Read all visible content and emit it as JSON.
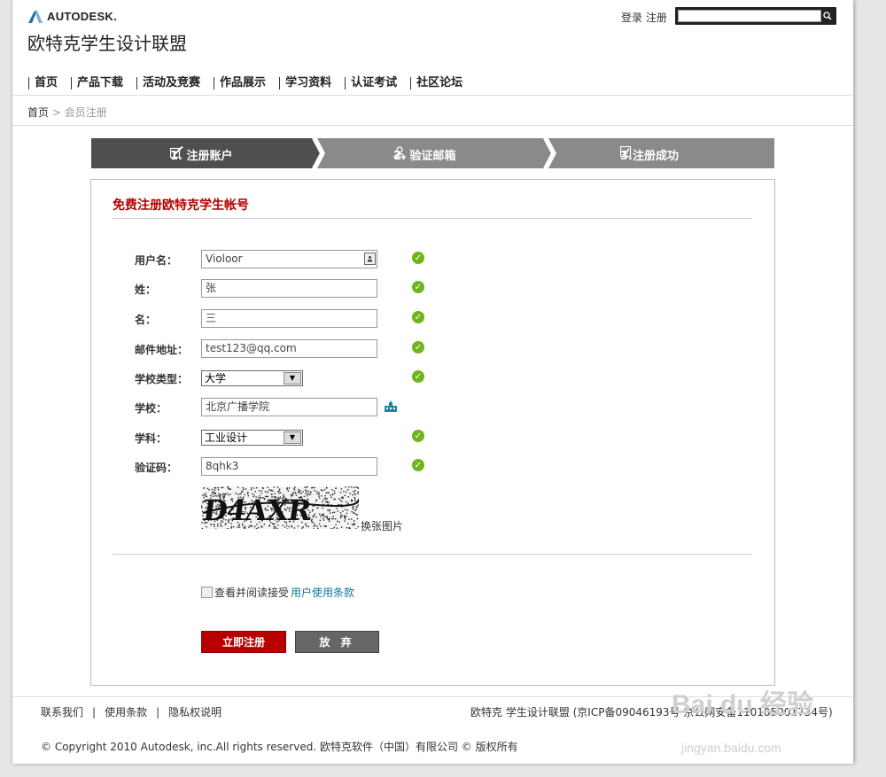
{
  "header": {
    "brand": "AUTODESK.",
    "site_title": "欧特克学生设计联盟",
    "login": "登录",
    "register": "注册",
    "search_placeholder": ""
  },
  "nav": [
    "首页",
    "产品下载",
    "活动及竞赛",
    "作品展示",
    "学习资料",
    "认证考试",
    "社区论坛"
  ],
  "breadcrumb": {
    "home": "首页",
    "sep": " > ",
    "current": "会员注册"
  },
  "steps": [
    {
      "label": "1. 注册账户",
      "icon": "pencil-icon",
      "state": "active"
    },
    {
      "label": "2. 验证邮箱",
      "icon": "user-icon",
      "state": "pending"
    },
    {
      "label": "3.注册成功",
      "icon": "checkbox-icon",
      "state": "pending"
    }
  ],
  "form": {
    "title": "免费注册欧特克学生帐号",
    "fields": {
      "username": {
        "label": "用户名：",
        "value": "Violoor"
      },
      "surname": {
        "label": "姓：",
        "value": "张"
      },
      "given_name": {
        "label": "名：",
        "value": "三"
      },
      "email": {
        "label": "邮件地址：",
        "value": "test123@qq.com"
      },
      "school_type": {
        "label": "学校类型：",
        "value": "大学"
      },
      "school": {
        "label": "学校：",
        "value": "北京广播学院"
      },
      "subject": {
        "label": "学科：",
        "value": "工业设计"
      },
      "captcha": {
        "label": "验证码：",
        "value": "8qhk3"
      }
    },
    "captcha_text": "D4AXR",
    "change_image": "换张图片",
    "agree_text": "查看并阅读接受",
    "agree_link": "用户使用条款",
    "submit": "立即注册",
    "cancel": "放 弃"
  },
  "footer": {
    "links": [
      "联系我们",
      "使用条款",
      "隐私权说明"
    ],
    "right": "欧特克 学生设计联盟 (京ICP备09046193号 京公网安备110105001734号)",
    "copyright": "© Copyright 2010 Autodesk, inc.All rights reserved. 欧特克软件（中国）有限公司 © 版权所有"
  },
  "watermark": {
    "main": "Bai du 经验",
    "sub": "jingyan.baidu.com"
  },
  "colors": {
    "accent_red": "#b80000",
    "ok_green": "#6fb51e",
    "step_active": "#4f4f4f",
    "step_pending": "#8a8a8a",
    "link": "#117799"
  }
}
